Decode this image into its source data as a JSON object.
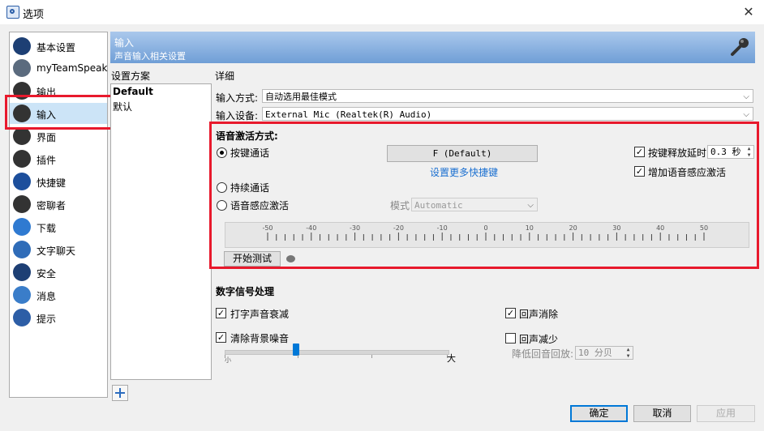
{
  "window": {
    "title": "选项"
  },
  "sidebar": {
    "items": [
      {
        "label": "基本设置",
        "icon": "ts-logo-icon",
        "color": "#1d3f74"
      },
      {
        "label": "myTeamSpeak",
        "icon": "user-icon",
        "color": "#5b6b7e"
      },
      {
        "label": "输出",
        "icon": "speaker-icon",
        "color": "#333333"
      },
      {
        "label": "输入",
        "icon": "microphone-icon",
        "color": "#333333"
      },
      {
        "label": "界面",
        "icon": "brush-icon",
        "color": "#333333"
      },
      {
        "label": "插件",
        "icon": "plugin-icon",
        "color": "#333333"
      },
      {
        "label": "快捷键",
        "icon": "keyboard-w-icon",
        "color": "#1d4f9c"
      },
      {
        "label": "密聊者",
        "icon": "whisper-icon",
        "color": "#333333"
      },
      {
        "label": "下载",
        "icon": "download-icon",
        "color": "#2f7ad1"
      },
      {
        "label": "文字聊天",
        "icon": "chat-a-icon",
        "color": "#2f6cb8"
      },
      {
        "label": "安全",
        "icon": "shield-icon",
        "color": "#1d3f74"
      },
      {
        "label": "消息",
        "icon": "abc-message-icon",
        "color": "#3a7dc9"
      },
      {
        "label": "提示",
        "icon": "info-icon",
        "color": "#2d5ea6"
      }
    ],
    "selected_index": 3
  },
  "header": {
    "title": "输入",
    "subtitle": "声音输入相关设置"
  },
  "profiles": {
    "label": "设置方案",
    "items": [
      "Default",
      "默认"
    ]
  },
  "details": {
    "label": "详细",
    "input_mode_label": "输入方式:",
    "input_mode_value": "自动选用最佳模式",
    "input_device_label": "输入设备:",
    "input_device_value": "External Mic (Realtek(R) Audio)"
  },
  "voice_activation": {
    "title": "语音激活方式:",
    "ptt_label": "按键通话",
    "ptt_hotkey": "F (Default)",
    "more_hotkeys_link": "设置更多快捷键",
    "continuous_label": "持续通话",
    "vad_label": "语音感应激活",
    "mode_label": "模式",
    "mode_value": "Automatic",
    "release_delay_label": "按键释放延时",
    "release_delay_value": "0.3 秒",
    "release_delay_checked": true,
    "add_vad_label": "增加语音感应激活",
    "add_vad_checked": true,
    "scale_labels": [
      "-50",
      "-40",
      "-30",
      "-20",
      "-10",
      "0",
      "10",
      "20",
      "30",
      "40",
      "50"
    ],
    "test_button": "开始测试",
    "selected_mode": "ptt"
  },
  "dsp": {
    "title": "数字信号处理",
    "typing_label": "打字声音衰减",
    "typing_checked": true,
    "echo_cancel_label": "回声消除",
    "echo_cancel_checked": true,
    "noise_label": "清除背景噪音",
    "noise_checked": true,
    "echo_reduce_label": "回声减少",
    "echo_reduce_checked": false,
    "slider_min": "小",
    "slider_max": "大",
    "noise_level": 0.32,
    "echo_reduce_value_label": "降低回音回放:",
    "echo_reduce_value": "10 分贝"
  },
  "buttons": {
    "ok": "确定",
    "cancel": "取消",
    "apply": "应用"
  },
  "colors": {
    "highlight": "#e8192c",
    "accent": "#0078d7",
    "selection": "#cce4f7"
  }
}
